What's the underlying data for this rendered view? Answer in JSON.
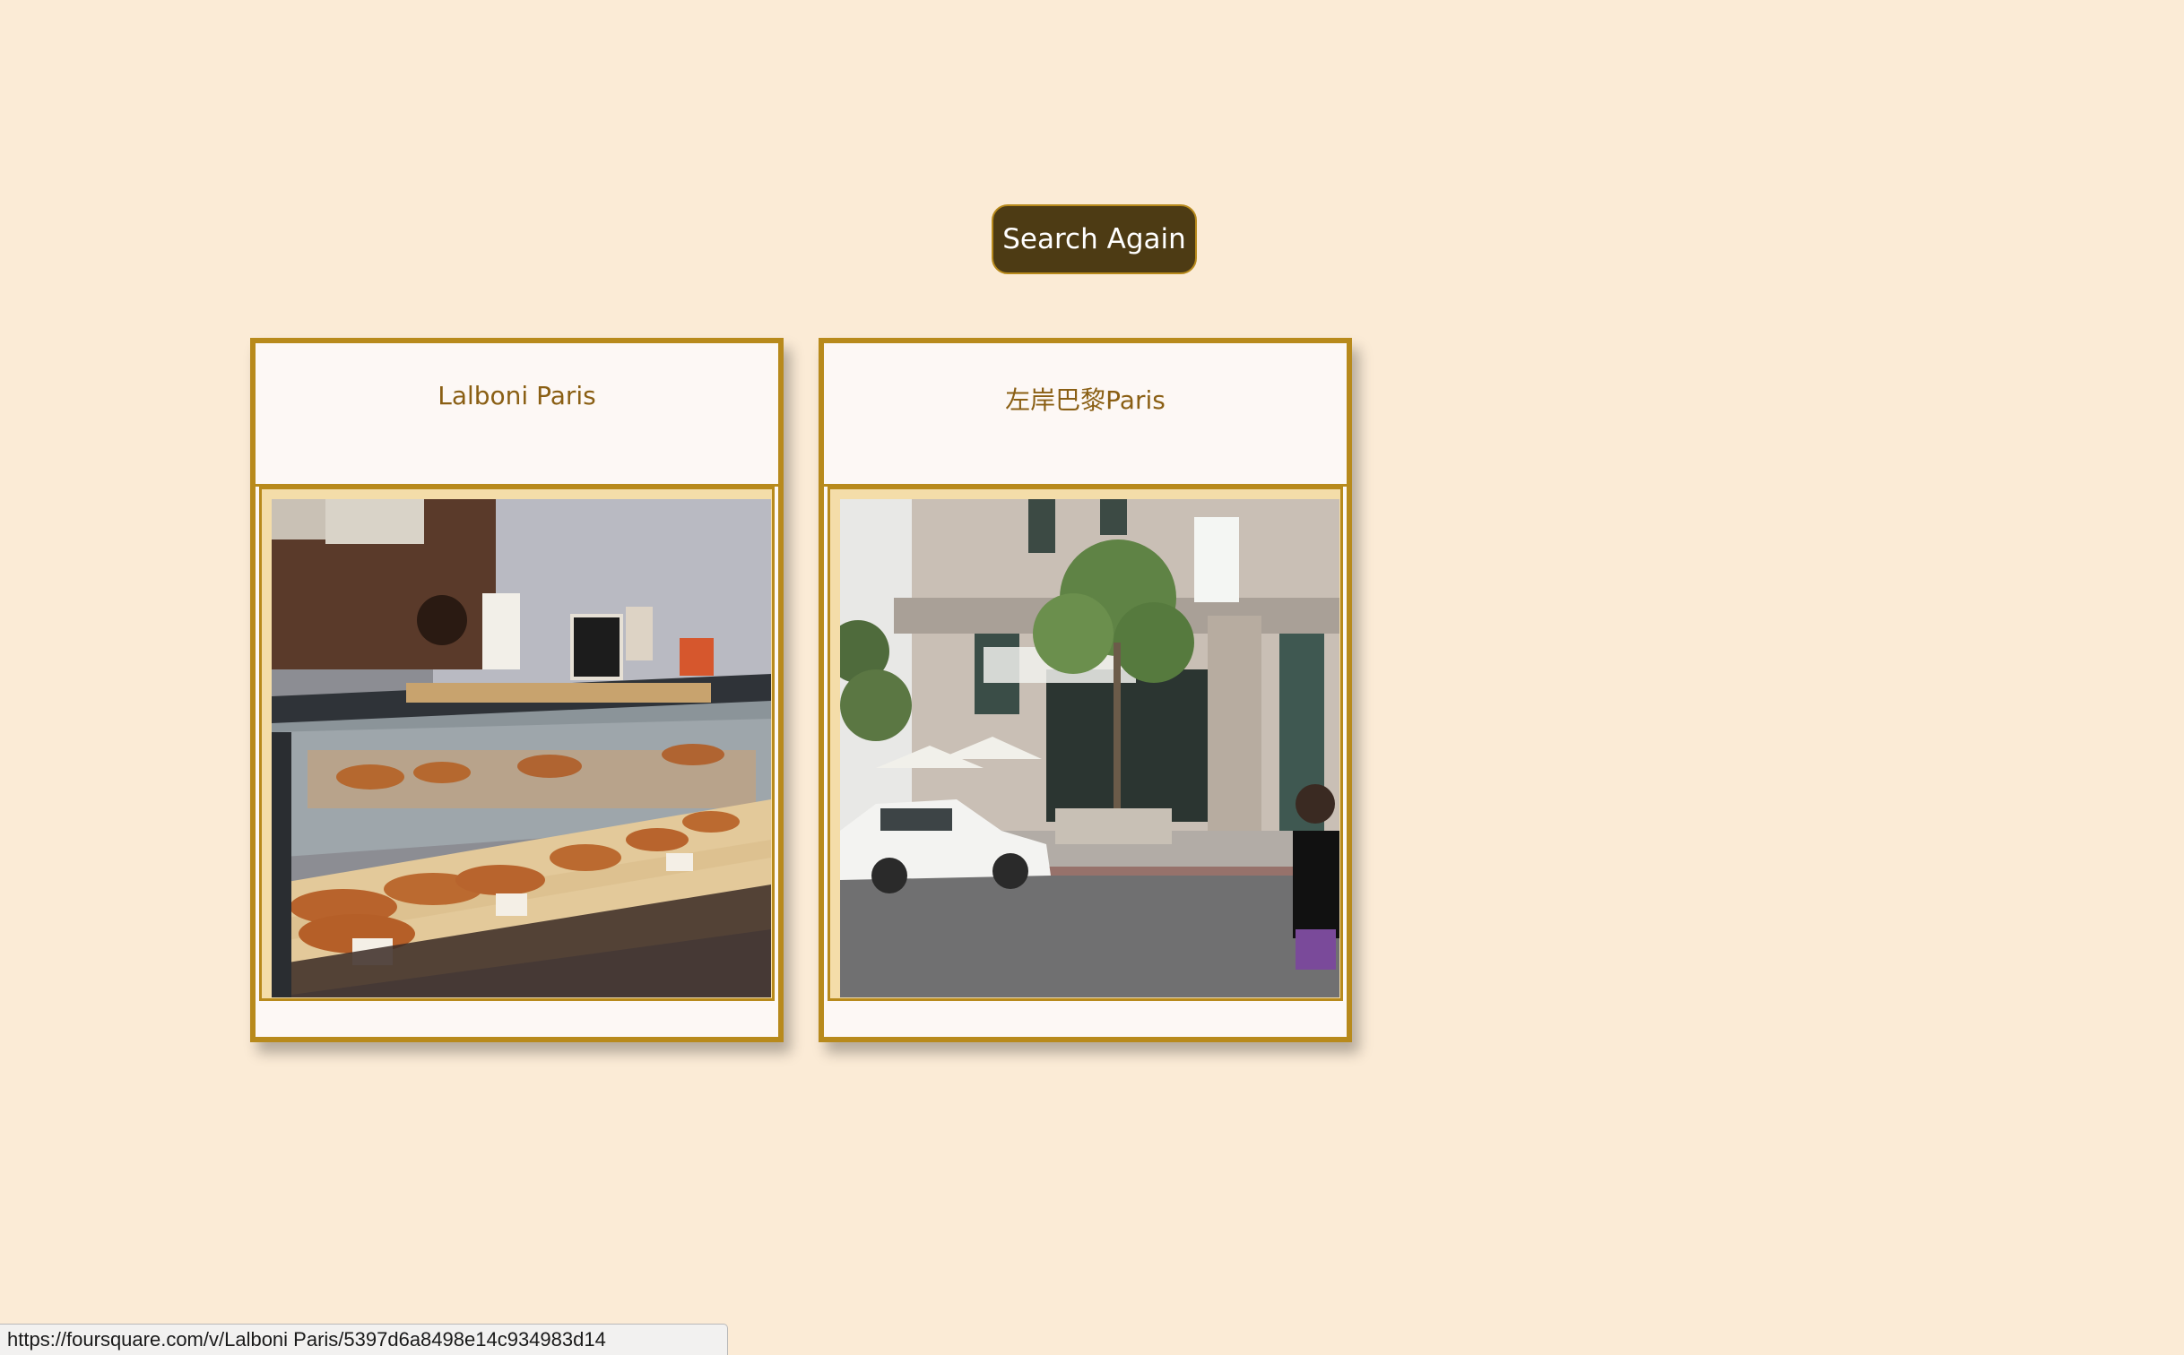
{
  "search_again_label": "Search Again",
  "results": [
    {
      "title": "Lalboni Paris"
    },
    {
      "title": "左岸巴黎Paris"
    }
  ],
  "status_bar": {
    "url": "https://foursquare.com/v/Lalboni Paris/5397d6a8498e14c934983d14"
  },
  "colors": {
    "background": "#fbebd6",
    "button_bg": "#4d3b14",
    "card_border": "#b88a1c",
    "title_text": "#8a5f14"
  }
}
